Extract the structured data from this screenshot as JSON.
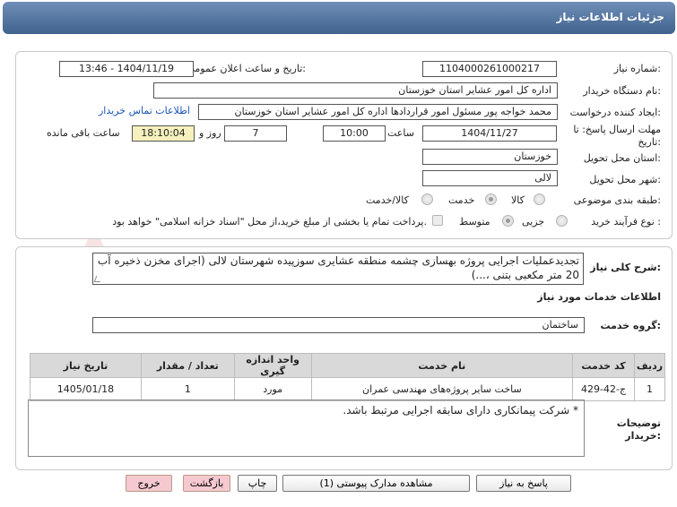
{
  "title": "جزئیات اطلاعات نیاز",
  "fields": {
    "need_number_label": "شماره نیاز:",
    "need_number": "1104000261000217",
    "announce_label": "تاریخ و ساعت اعلان عمومی:",
    "announce_value": "1404/11/19 - 13:46",
    "buyer_org_label": "نام دستگاه خریدار:",
    "buyer_org": "اداره کل امور عشایر استان خوزستان",
    "creator_label": "ایجاد کننده درخواست:",
    "creator": "محمد خواجه پور مسئول امور قراردادها اداره کل امور عشایر استان خوزستان",
    "contact_link": "اطلاعات تماس خریدار",
    "deadline_label_1": "مهلت ارسال پاسخ: تا",
    "deadline_label_2": "تاریخ:",
    "deadline_date": "1404/11/27",
    "time_label": "ساعت",
    "deadline_time": "10:00",
    "days_value": "7",
    "days_label": "روز و",
    "remaining_time": "18:10:04",
    "remaining_label": "ساعت باقی مانده",
    "province_label": "استان محل تحویل:",
    "province": "خوزستان",
    "city_label": "شهر محل تحویل:",
    "city": "لالی",
    "category_label": "طبقه بندی موضوعی:",
    "category_options": [
      "کالا",
      "خدمت",
      "کالا/خدمت"
    ],
    "process_label": "نوع فرآیند خرید :",
    "process_options": [
      "جزیی",
      "متوسط"
    ],
    "payment_note": "پرداخت تمام یا بخشی از مبلغ خرید،از محل \"اسناد خزانه اسلامی\" خواهد بود."
  },
  "description": {
    "label": "شرح کلی نیاز:",
    "text": "تجدیدعملیات اجرایی پروژه بهسازی چشمه منطقه عشایری سوزپیده  شهرستان لالی (اجرای مخزن ذخیره آب 20 متر مکعبی بتنی ،...)"
  },
  "services": {
    "section_title": "اطلاعات خدمات مورد نیاز",
    "group_label": "گروه خدمت:",
    "group_value": "ساختمان",
    "columns": [
      "ردیف",
      "کد خدمت",
      "نام خدمت",
      "واحد اندازه گیری",
      "تعداد / مقدار",
      "تاریخ نیاز"
    ],
    "rows": [
      [
        "1",
        "ج-42-429",
        "ساخت سایر پروژه‌های مهندسی عمران",
        "مورد",
        "1",
        "1405/01/18"
      ]
    ]
  },
  "buyer_notes": {
    "label_1": "توضیحات",
    "label_2": "خریدار:",
    "text": "* شرکت پیمانکاری دارای سابقه اجرایی مرتبط باشد."
  },
  "buttons": {
    "reply": "پاسخ به نیاز",
    "attachments": "مشاهده مدارک پیوستی (1)",
    "print": "چاپ",
    "back": "بازگشت",
    "exit": "خروج"
  },
  "watermark": "AriaTender.net",
  "colors": {
    "title_bar": "#4a6b96",
    "pink_button": "#f5c9cf",
    "yellow_box": "#f5f0bd",
    "link": "#1a55b5"
  }
}
